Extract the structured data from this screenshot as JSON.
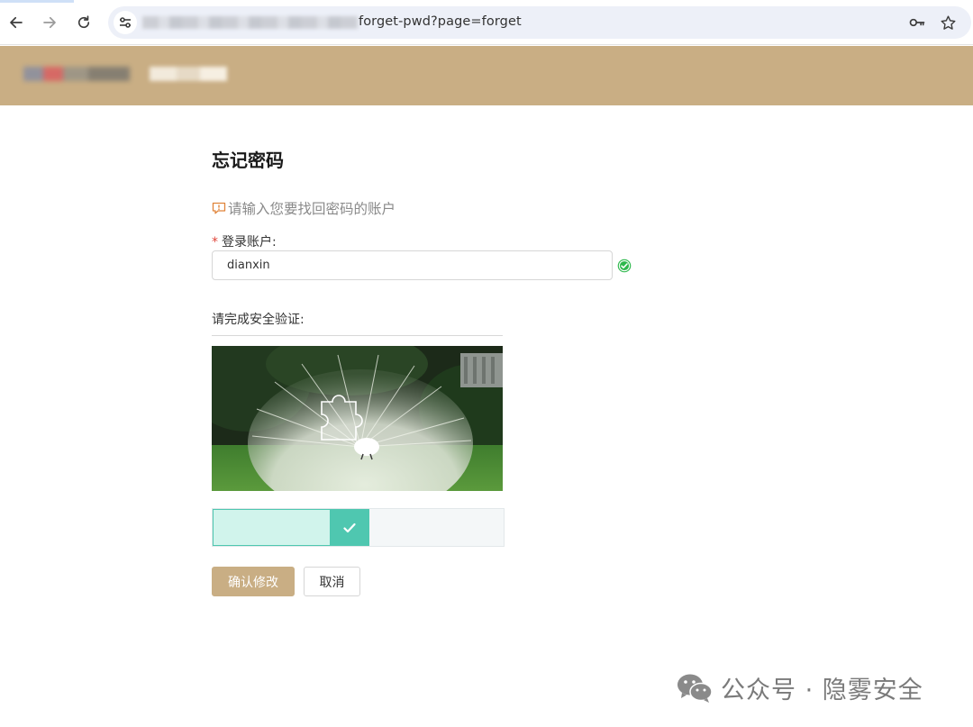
{
  "browser": {
    "url_visible": "forget-pwd?page=forget",
    "icons": [
      "back-arrow-icon",
      "forward-arrow-icon",
      "reload-icon",
      "site-settings-icon",
      "password-key-icon",
      "bookmark-star-icon"
    ]
  },
  "header": {
    "bg_color": "#c9ae84"
  },
  "form": {
    "title": "忘记密码",
    "hint": "请输入您要找回密码的账户",
    "account_label": "登录账户:",
    "required_mark": "*",
    "account_value": "dianxin",
    "verify_label": "请完成安全验证:"
  },
  "slider": {
    "progress_percent": 54,
    "status": "success"
  },
  "buttons": {
    "confirm": "确认修改",
    "cancel": "取消"
  },
  "watermark": {
    "text": "公众号 · 隐雾安全"
  },
  "colors": {
    "accent": "#c9ae84",
    "success_green": "#2db84c",
    "slider_teal": "#4fc7b0",
    "slider_fill": "#d1f4ec",
    "required_red": "#e0453a"
  }
}
